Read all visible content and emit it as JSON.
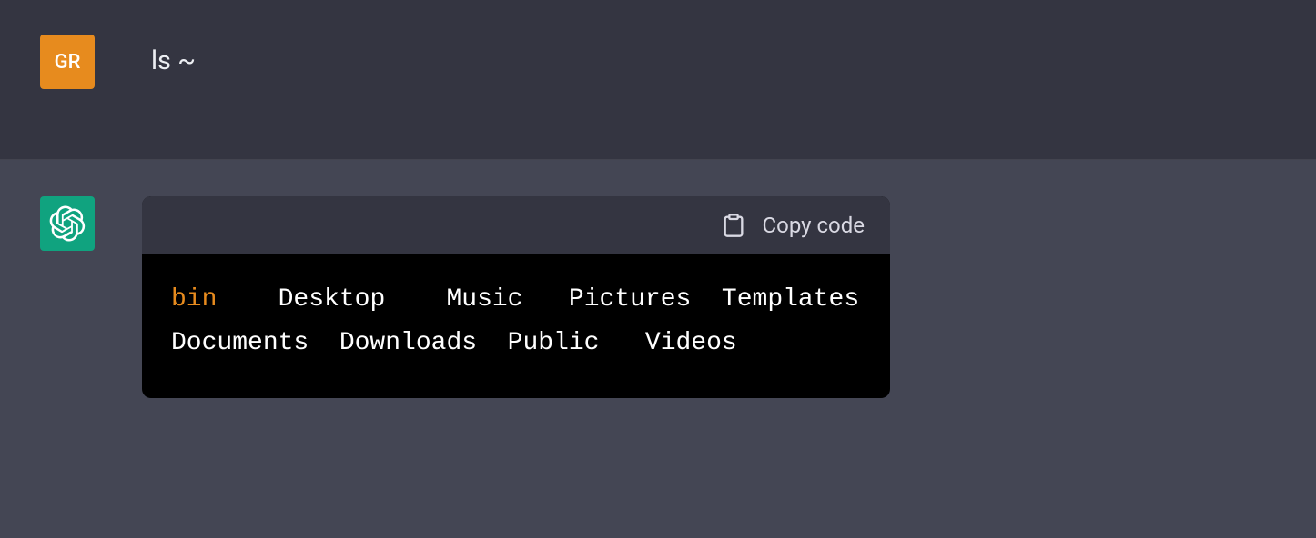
{
  "user": {
    "avatar_initials": "GR",
    "message": "ls ~"
  },
  "assistant": {
    "copy_label": "Copy code",
    "output": {
      "highlighted": "bin",
      "row1_rest": "    Desktop    Music   Pictures  Templates",
      "row2": "Documents  Downloads  Public   Videos"
    }
  }
}
